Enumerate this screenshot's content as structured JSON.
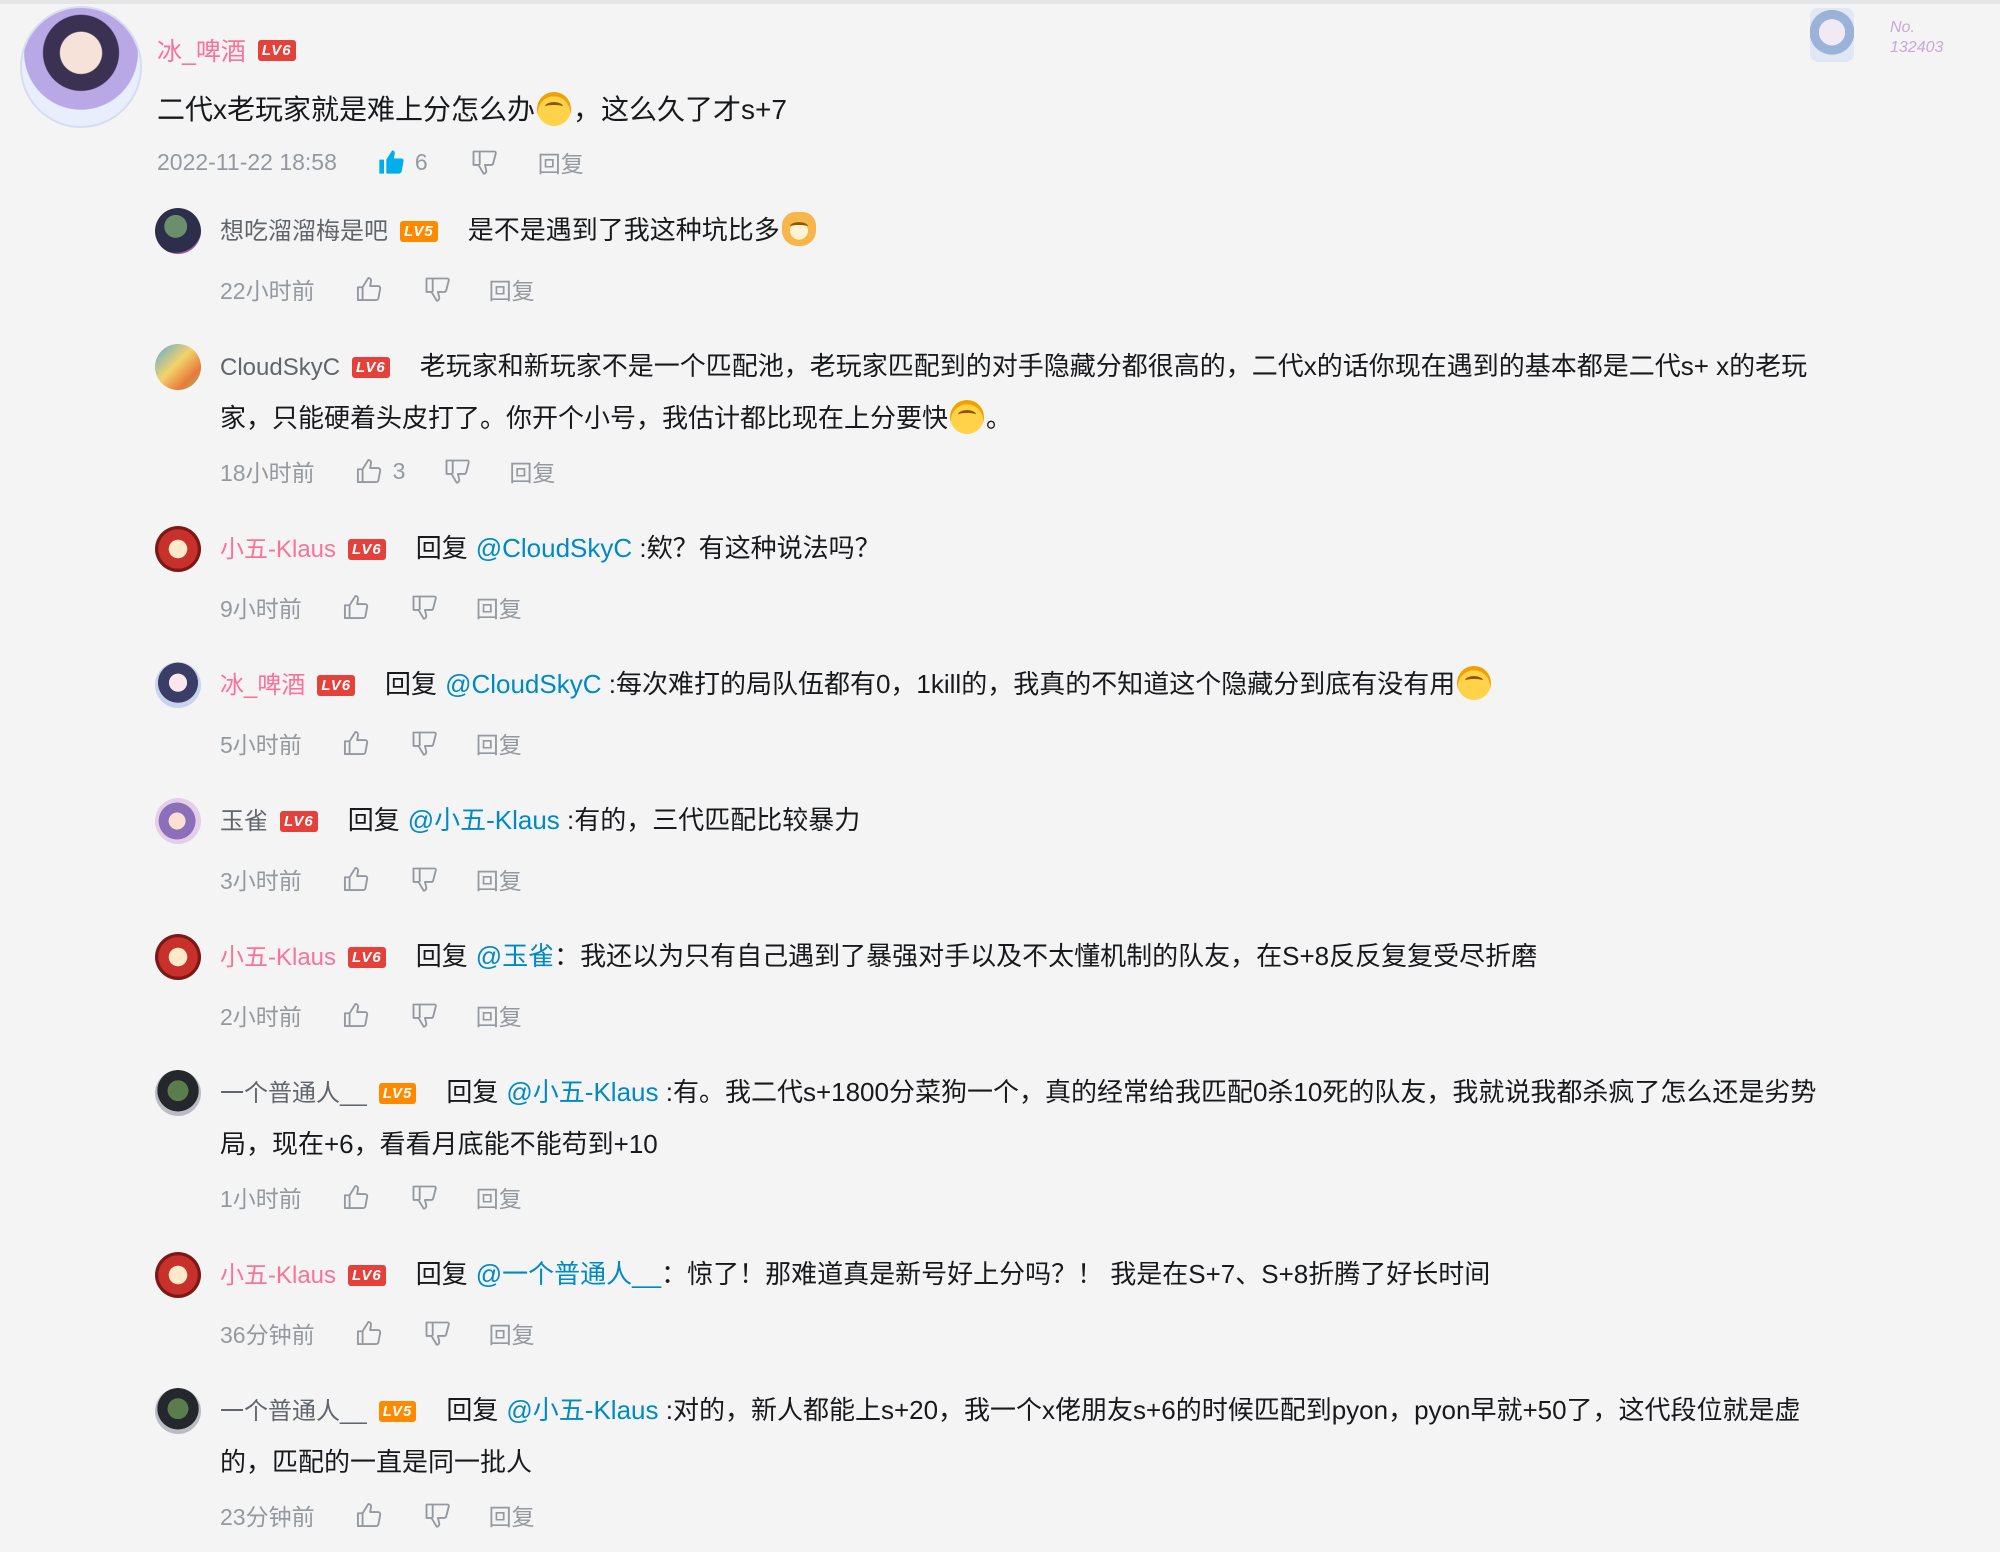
{
  "main": {
    "user": "冰_啤酒",
    "level": "LV6",
    "text_before": "二代x老玩家就是难上分怎么办",
    "text_after": "，这么久了才s+7",
    "time": "2022-11-22 18:58",
    "likes": "6",
    "reply_label": "回复",
    "badge_no": "No.",
    "badge_number": "132403",
    "colors": {
      "username": "#fb7299",
      "like_active": "#00aeec"
    }
  },
  "replies": [
    {
      "user": "想吃溜溜梅是吧",
      "level": "LV5",
      "text_before": "是不是遇到了我这种坑比多",
      "time": "22小时前",
      "reply_label": "回复"
    },
    {
      "user": "CloudSkyC",
      "level": "LV6",
      "text_line1": "老玩家和新玩家不是一个匹配池，老玩家匹配到的对手隐藏分都很高的，二代x的话你现在遇到的基本都是二代s+ x的老玩",
      "text_line2": "家，只能硬着头皮打了。你开个小号，我估计都比现在上分要快",
      "text_end": "。",
      "time": "18小时前",
      "likes": "3",
      "reply_label": "回复"
    },
    {
      "user": "小五-Klaus",
      "level": "LV6",
      "prefix": "回复",
      "mention": "@CloudSkyC",
      "text": " :欸？有这种说法吗？",
      "time": "9小时前",
      "reply_label": "回复"
    },
    {
      "user": "冰_啤酒",
      "level": "LV6",
      "prefix": "回复",
      "mention": "@CloudSkyC",
      "text": " :每次难打的局队伍都有0，1kill的，我真的不知道这个隐藏分到底有没有用",
      "time": "5小时前",
      "reply_label": "回复"
    },
    {
      "user": "玉雀",
      "level": "LV6",
      "prefix": "回复",
      "mention": "@小五-Klaus",
      "text": " :有的，三代匹配比较暴力",
      "time": "3小时前",
      "reply_label": "回复"
    },
    {
      "user": "小五-Klaus",
      "level": "LV6",
      "prefix": "回复",
      "mention": "@玉雀",
      "text": "：我还以为只有自己遇到了暴强对手以及不太懂机制的队友，在S+8反反复复受尽折磨",
      "time": "2小时前",
      "reply_label": "回复"
    },
    {
      "user": "一个普通人__",
      "level": "LV5",
      "prefix": "回复",
      "mention": "@小五-Klaus",
      "text_line1": " :有。我二代s+1800分菜狗一个，真的经常给我匹配0杀10死的队友，我就说我都杀疯了怎么还是劣势",
      "text_line2": "局，现在+6，看看月底能不能苟到+10",
      "time": "1小时前",
      "reply_label": "回复"
    },
    {
      "user": "小五-Klaus",
      "level": "LV6",
      "prefix": "回复",
      "mention": "@一个普通人__",
      "text": "：惊了！那难道真是新号好上分吗？！ 我是在S+7、S+8折腾了好长时间",
      "time": "36分钟前",
      "reply_label": "回复"
    },
    {
      "user": "一个普通人__",
      "level": "LV5",
      "prefix": "回复",
      "mention": "@小五-Klaus",
      "text_line1": " :对的，新人都能上s+20，我一个x佬朋友s+6的时候匹配到pyon，pyon早就+50了，这代段位就是虚",
      "text_line2": "的，匹配的一直是同一批人",
      "time": "23分钟前",
      "reply_label": "回复"
    }
  ]
}
